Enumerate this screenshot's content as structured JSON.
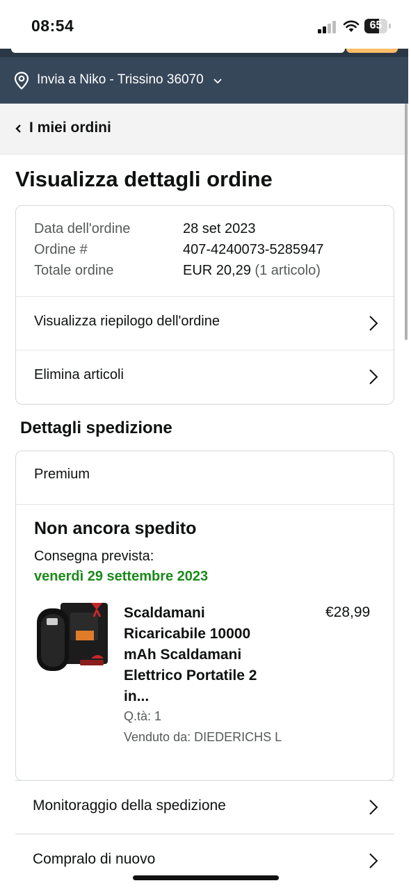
{
  "status_bar": {
    "time": "08:54",
    "battery": "65",
    "battery_level": 0.65
  },
  "delivery_bar": {
    "text": "Invia a Niko - Trissino 36070",
    "pin_icon": "location-pin-icon",
    "chevron_icon": "chevron-down-icon"
  },
  "back_nav": {
    "label": "I miei ordini"
  },
  "page": {
    "title": "Visualizza dettagli ordine"
  },
  "order_info": {
    "date_label": "Data dell'ordine",
    "date_value": "28 set 2023",
    "number_label": "Ordine #",
    "number_value": "407-4240073-5285947",
    "total_label": "Totale ordine",
    "total_value": "EUR 20,29",
    "total_items": "(1 articolo)"
  },
  "order_actions": [
    {
      "label": "Visualizza riepilogo dell'ordine"
    },
    {
      "label": "Elimina articoli"
    }
  ],
  "shipping": {
    "heading": "Dettagli spedizione",
    "speed": "Premium",
    "status": "Non ancora spedito",
    "expected_label": "Consegna prevista:",
    "expected_date": "venerdì 29 settembre 2023",
    "date_color": "#1a8a1a",
    "product": {
      "name": "Scaldamani Ricaricabile 10000 mAh Scaldamani Elettrico Portatile 2 in...",
      "price": "€28,99",
      "quantity": "Q.tà: 1",
      "seller": "Venduto da: DIEDERICHS L"
    }
  },
  "bottom_actions": [
    {
      "label": "Monitoraggio della spedizione"
    },
    {
      "label": "Compralo di nuovo"
    }
  ],
  "colors": {
    "header_dark": "#2a3744",
    "delivery_bar": "#37475a",
    "accent_orange": "#febd69"
  }
}
